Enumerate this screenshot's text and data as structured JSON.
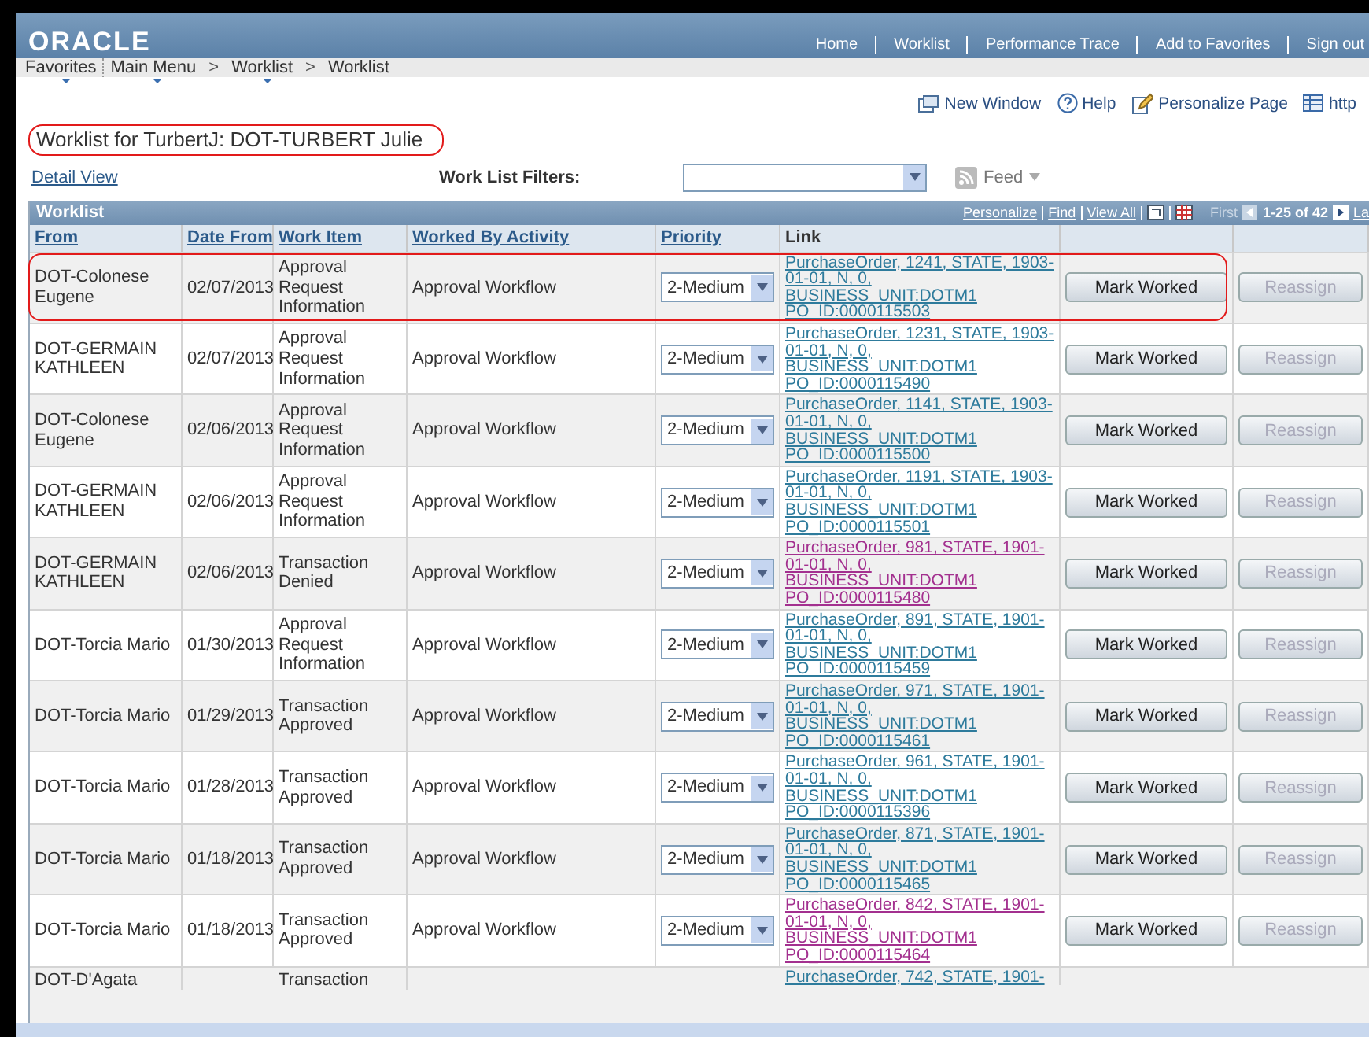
{
  "header": {
    "logo": "ORACLE",
    "nav": [
      "Home",
      "Worklist",
      "Performance Trace",
      "Add to Favorites",
      "Sign out"
    ]
  },
  "breadcrumb": [
    {
      "label": "Favorites",
      "has_menu": true
    },
    {
      "label": "Main Menu",
      "has_menu": true
    },
    {
      "label": "Worklist",
      "has_menu": true,
      "separator": ">"
    },
    {
      "label": "Worklist",
      "has_menu": false,
      "separator": ">"
    }
  ],
  "toolbar": [
    {
      "kind": "window",
      "label": "New Window"
    },
    {
      "kind": "help",
      "label": "Help"
    },
    {
      "kind": "personalize",
      "label": "Personalize Page"
    },
    {
      "kind": "grid",
      "label": "http"
    }
  ],
  "page_title": {
    "text": "Worklist for TurbertJ: DOT-TURBERT Julie",
    "highlighted": true
  },
  "detail_view": "Detail View",
  "filters": {
    "label": "Work List Filters:",
    "feed": "Feed"
  },
  "grid": {
    "title": "Worklist",
    "links": [
      "Personalize",
      "Find",
      "View All"
    ],
    "first": "First",
    "range": "1-25 of 42",
    "last": "La",
    "columns": [
      "From",
      "Date From",
      "Work Item",
      "Worked By Activity",
      "Priority",
      "Link"
    ],
    "rows": [
      {
        "from": "DOT-Colonese Eugene",
        "date": "02/07/2013",
        "item": "Approval Request Information",
        "activity": "Approval Workflow",
        "priority": "2-Medium",
        "link": "PurchaseOrder, 1241, STATE, 1903-01-01, N, 0, BUSINESS_UNIT:DOTM1 PO_ID:0000115503",
        "visited": false,
        "highlighted": true,
        "mark": "Mark Worked",
        "reassign": "Reassign"
      },
      {
        "from": "DOT-GERMAIN KATHLEEN",
        "date": "02/07/2013",
        "item": "Approval Request Information",
        "activity": "Approval Workflow",
        "priority": "2-Medium",
        "link": "PurchaseOrder, 1231, STATE, 1903-01-01, N, 0, BUSINESS_UNIT:DOTM1 PO_ID:0000115490",
        "visited": false,
        "highlighted": false,
        "mark": "Mark Worked",
        "reassign": "Reassign"
      },
      {
        "from": "DOT-Colonese Eugene",
        "date": "02/06/2013",
        "item": "Approval Request Information",
        "activity": "Approval Workflow",
        "priority": "2-Medium",
        "link": "PurchaseOrder, 1141, STATE, 1903-01-01, N, 0, BUSINESS_UNIT:DOTM1 PO_ID:0000115500",
        "visited": false,
        "highlighted": false,
        "mark": "Mark Worked",
        "reassign": "Reassign"
      },
      {
        "from": "DOT-GERMAIN KATHLEEN",
        "date": "02/06/2013",
        "item": "Approval Request Information",
        "activity": "Approval Workflow",
        "priority": "2-Medium",
        "link": "PurchaseOrder, 1191, STATE, 1903-01-01, N, 0, BUSINESS_UNIT:DOTM1 PO_ID:0000115501",
        "visited": false,
        "highlighted": false,
        "mark": "Mark Worked",
        "reassign": "Reassign"
      },
      {
        "from": "DOT-GERMAIN KATHLEEN",
        "date": "02/06/2013",
        "item": "Transaction Denied",
        "activity": "Approval Workflow",
        "priority": "2-Medium",
        "link": "PurchaseOrder, 981, STATE, 1901-01-01, N, 0, BUSINESS_UNIT:DOTM1 PO_ID:0000115480",
        "visited": true,
        "highlighted": false,
        "mark": "Mark Worked",
        "reassign": "Reassign"
      },
      {
        "from": "DOT-Torcia Mario",
        "date": "01/30/2013",
        "item": "Approval Request Information",
        "activity": "Approval Workflow",
        "priority": "2-Medium",
        "link": "PurchaseOrder, 891, STATE, 1901-01-01, N, 0, BUSINESS_UNIT:DOTM1 PO_ID:0000115459",
        "visited": false,
        "highlighted": false,
        "mark": "Mark Worked",
        "reassign": "Reassign"
      },
      {
        "from": "DOT-Torcia Mario",
        "date": "01/29/2013",
        "item": "Transaction Approved",
        "activity": "Approval Workflow",
        "priority": "2-Medium",
        "link": "PurchaseOrder, 971, STATE, 1901-01-01, N, 0, BUSINESS_UNIT:DOTM1 PO_ID:0000115461",
        "visited": false,
        "highlighted": false,
        "mark": "Mark Worked",
        "reassign": "Reassign"
      },
      {
        "from": "DOT-Torcia Mario",
        "date": "01/28/2013",
        "item": "Transaction Approved",
        "activity": "Approval Workflow",
        "priority": "2-Medium",
        "link": "PurchaseOrder, 961, STATE, 1901-01-01, N, 0, BUSINESS_UNIT:DOTM1 PO_ID:0000115396",
        "visited": false,
        "highlighted": false,
        "mark": "Mark Worked",
        "reassign": "Reassign"
      },
      {
        "from": "DOT-Torcia Mario",
        "date": "01/18/2013",
        "item": "Transaction Approved",
        "activity": "Approval Workflow",
        "priority": "2-Medium",
        "link": "PurchaseOrder, 871, STATE, 1901-01-01, N, 0, BUSINESS_UNIT:DOTM1 PO_ID:0000115465",
        "visited": false,
        "highlighted": false,
        "mark": "Mark Worked",
        "reassign": "Reassign"
      },
      {
        "from": "DOT-Torcia Mario",
        "date": "01/18/2013",
        "item": "Transaction Approved",
        "activity": "Approval Workflow",
        "priority": "2-Medium",
        "link": "PurchaseOrder, 842, STATE, 1901-01-01, N, 0, BUSINESS_UNIT:DOTM1 PO_ID:0000115464",
        "visited": true,
        "highlighted": false,
        "mark": "Mark Worked",
        "reassign": "Reassign"
      }
    ],
    "partial_row": {
      "from": "DOT-D'Agata",
      "item": "Transaction",
      "link": "PurchaseOrder, 742, STATE, 1901-"
    }
  }
}
